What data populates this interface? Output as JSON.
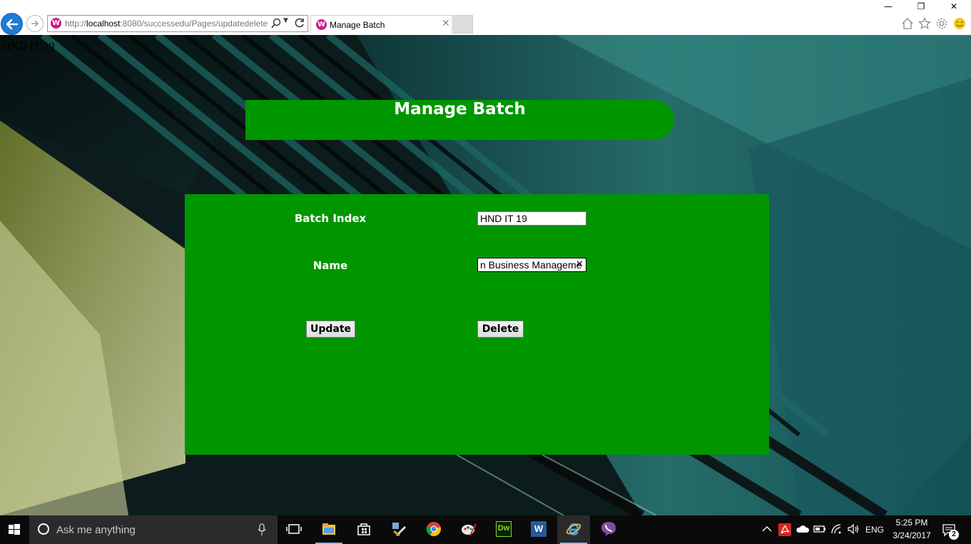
{
  "browser": {
    "url_prefix": "http://",
    "url_host": "localhost",
    "url_rest": ":8080/successedu/Pages/updatedelete",
    "tab_title": "Manage Batch",
    "site_icon_letter": "W",
    "window_controls": {
      "minimize": "—",
      "restore": "❐",
      "close": "✕"
    }
  },
  "page": {
    "corner_label": "HND IT 19",
    "header_title": "Manage Batch",
    "form": {
      "batch_index_label": "Batch Index",
      "batch_index_value": "HND IT 19",
      "name_label": "Name",
      "name_value": "n Business Manageme",
      "update_button": "Update",
      "delete_button": "Delete"
    },
    "colors": {
      "panel_green": "#009600",
      "text_white": "#ffffff"
    }
  },
  "taskbar": {
    "search_placeholder": "Ask me anything",
    "apps": [
      "file-explorer-icon",
      "store-icon",
      "tools-icon",
      "chrome-icon",
      "paint-icon",
      "dreamweaver-icon",
      "word-icon",
      "ie-icon",
      "viber-icon"
    ],
    "dreamweaver_label": "Dw",
    "word_label": "W",
    "tray": {
      "language": "ENG",
      "time": "5:25 PM",
      "date": "3/24/2017",
      "notification_count": "2"
    }
  }
}
